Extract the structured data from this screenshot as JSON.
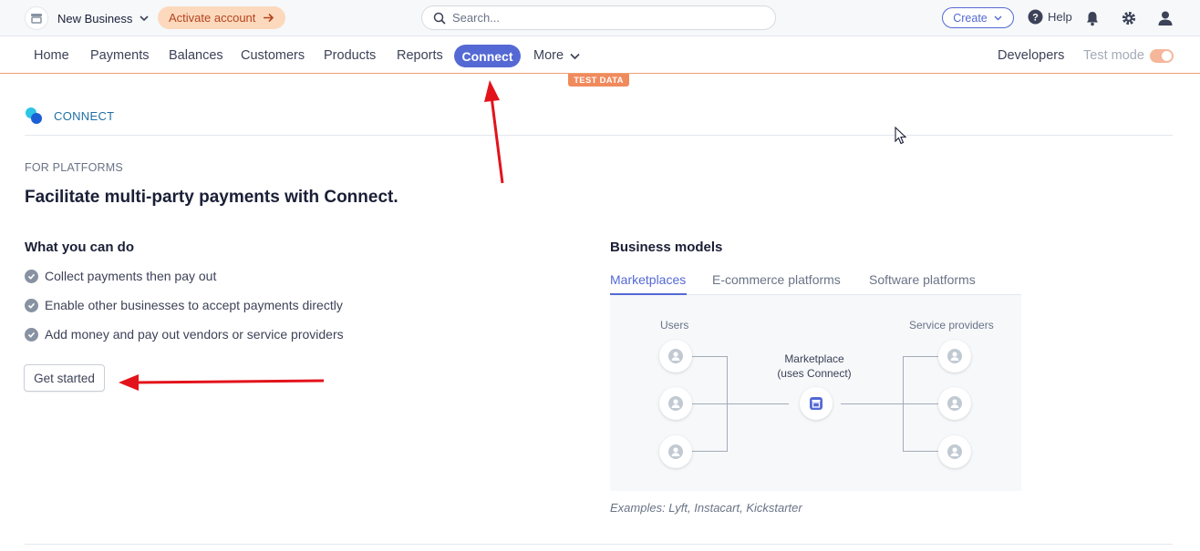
{
  "topbar": {
    "business_name": "New Business",
    "activate_label": "Activate account",
    "search_placeholder": "Search...",
    "create_label": "Create",
    "help_label": "Help"
  },
  "nav": {
    "items": [
      "Home",
      "Payments",
      "Balances",
      "Customers",
      "Products",
      "Reports"
    ],
    "active_label": "Connect",
    "more_label": "More",
    "developers_label": "Developers",
    "test_mode_label": "Test mode",
    "test_mode_on": true,
    "test_data_badge": "TEST DATA"
  },
  "page": {
    "section_label": "CONNECT",
    "eyebrow": "FOR PLATFORMS",
    "headline": "Facilitate multi-party payments with Connect."
  },
  "what_you_can_do": {
    "title": "What you can do",
    "features": [
      "Collect payments then pay out",
      "Enable other businesses to accept payments directly",
      "Add money and pay out vendors or service providers"
    ],
    "button_label": "Get started"
  },
  "business_models": {
    "title": "Business models",
    "tabs": [
      "Marketplaces",
      "E-commerce platforms",
      "Software platforms"
    ],
    "active_tab": "Marketplaces",
    "diagram": {
      "left_label": "Users",
      "right_label": "Service providers",
      "center_label_line1": "Marketplace",
      "center_label_line2": "(uses Connect)"
    },
    "examples": "Examples: Lyft, Instacart, Kickstarter"
  },
  "colors": {
    "accent": "#5469d4",
    "annotation_arrow": "#e3131b",
    "activate_bg": "#fcd9bd",
    "test_badge": "#f08a5d"
  }
}
